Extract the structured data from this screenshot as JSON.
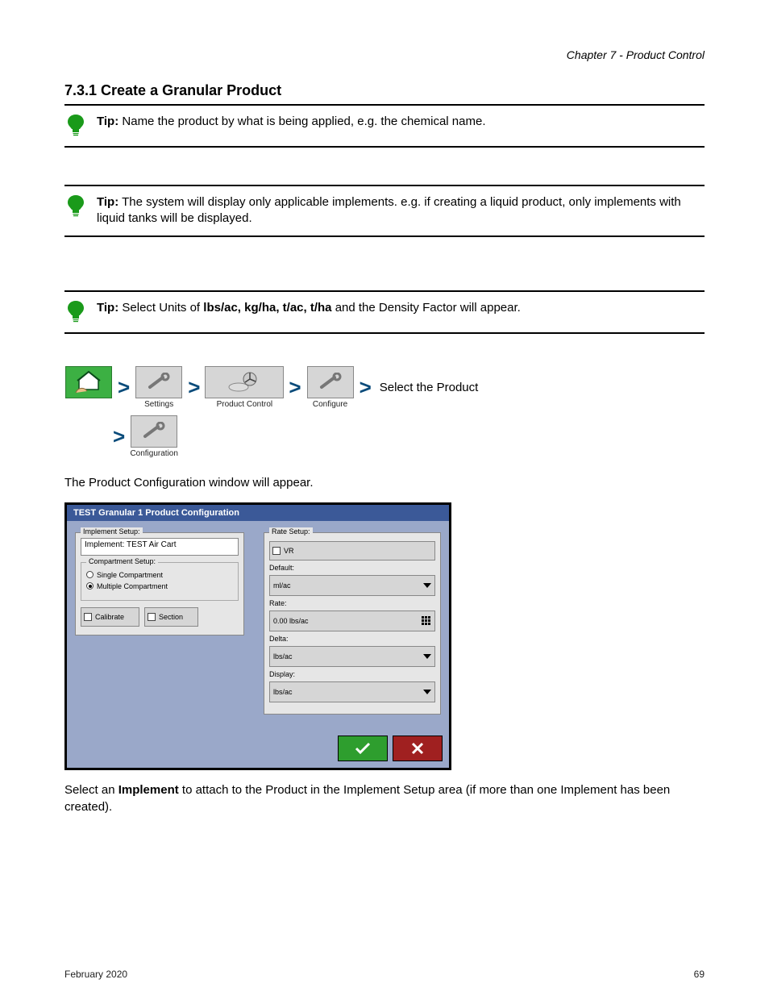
{
  "running_header": "Chapter 7 - Product Control",
  "heading": "7.3.1 Create a Granular Product",
  "tip1": {
    "title": "Tip:",
    "text": "Name the product by what is being applied, e.g. the chemical name."
  },
  "tip2": {
    "title": "Tip:",
    "text": "The system will display only applicable implements. e.g. if creating a liquid product, only implements with liquid tanks will be displayed."
  },
  "tip3_title_text": {
    "title": "Tip:",
    "text": "and the Density Factor will appear."
  },
  "tip3_pre": "Select Units of",
  "tip3_emph": "lbs/ac, kg/ha, t/ac, t/ha",
  "navpath": {
    "settings": "Settings",
    "product": "Product Control",
    "configure1": "Configure",
    "trail1": "Select the Product",
    "configure2": "Configuration"
  },
  "dialog": {
    "title": "TEST Granular 1 Product Configuration",
    "left": {
      "group": "Implement Setup:",
      "implement": "Implement: TEST Air Cart",
      "compartment_label": "Compartment Setup:",
      "single": "Single Compartment",
      "multi": "Multiple Compartment",
      "calibrate": "Calibrate",
      "section": "Section"
    },
    "right": {
      "group": "Rate Setup:",
      "vr": "VR",
      "default": "Default:",
      "default_val": "ml/ac",
      "rate": "Rate:",
      "rate_val": "0.00 lbs/ac",
      "delta": "Delta:",
      "delta_val": "lbs/ac",
      "display": "Display:",
      "display_val": "lbs/ac"
    }
  },
  "body1": "The Product Configuration window will appear.",
  "body2_a": "Select an ",
  "body2_b": "Implement",
  "body2_c": " to attach to the Product in the Implement Setup area (if more than one Implement has been created).",
  "footer_left": "February 2020",
  "footer_right": "69"
}
